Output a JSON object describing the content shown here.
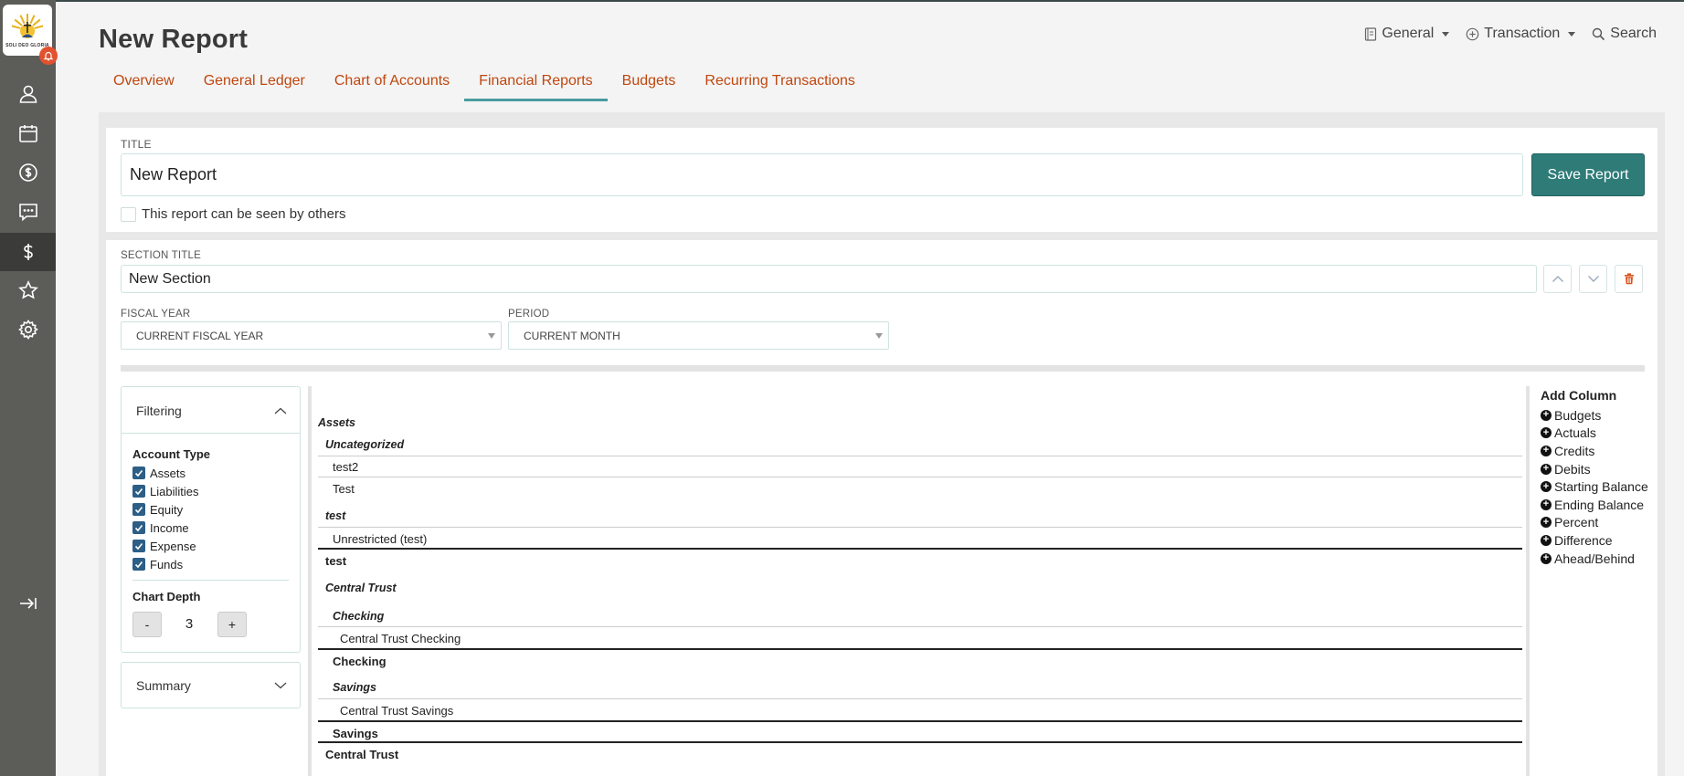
{
  "header": {
    "title": "New Report",
    "right": [
      {
        "label": "General",
        "icon": "book-icon",
        "dropdown": true
      },
      {
        "label": "Transaction",
        "icon": "plus-circle-icon",
        "dropdown": true
      },
      {
        "label": "Search",
        "icon": "search-icon",
        "dropdown": false
      }
    ]
  },
  "tabs": [
    "Overview",
    "General Ledger",
    "Chart of Accounts",
    "Financial Reports",
    "Budgets",
    "Recurring Transactions"
  ],
  "activeTab": "Financial Reports",
  "logo": {
    "text": "SOLI DEO GLORIA"
  },
  "report": {
    "title_label": "TITLE",
    "title_value": "New Report",
    "save_label": "Save Report",
    "visibility_label": "This report can be seen by others"
  },
  "section": {
    "title_label": "SECTION TITLE",
    "title_value": "New Section",
    "fiscal_label": "FISCAL YEAR",
    "fiscal_value": "CURRENT FISCAL YEAR",
    "period_label": "PERIOD",
    "period_value": "CURRENT MONTH"
  },
  "filter": {
    "heading": "Filtering",
    "account_type_label": "Account Type",
    "account_types": [
      "Assets",
      "Liabilities",
      "Equity",
      "Income",
      "Expense",
      "Funds"
    ],
    "chart_depth_label": "Chart Depth",
    "chart_depth_value": "3",
    "minus": "-",
    "plus": "+",
    "summary_heading": "Summary"
  },
  "tree": [
    {
      "text": "Assets",
      "style": "bi"
    },
    {
      "text": "Uncategorized",
      "style": "bi"
    },
    {
      "text": "test2",
      "style": "n"
    },
    {
      "text": "Test",
      "style": "n"
    },
    {
      "text": "test",
      "style": "bi"
    },
    {
      "text": "Unrestricted (test)",
      "style": "n"
    },
    {
      "text": "test",
      "style": "b"
    },
    {
      "text": "Central Trust",
      "style": "bi"
    },
    {
      "text": "Checking",
      "style": "bi"
    },
    {
      "text": "Central Trust Checking",
      "style": "n"
    },
    {
      "text": "Checking",
      "style": "b"
    },
    {
      "text": "Savings",
      "style": "bi"
    },
    {
      "text": "Central Trust Savings",
      "style": "n"
    },
    {
      "text": "Savings",
      "style": "b"
    },
    {
      "text": "Central Trust",
      "style": "b"
    }
  ],
  "addColumn": {
    "heading": "Add Column",
    "items": [
      "Budgets",
      "Actuals",
      "Credits",
      "Debits",
      "Starting Balance",
      "Ending Balance",
      "Percent",
      "Difference",
      "Ahead/Behind"
    ]
  }
}
